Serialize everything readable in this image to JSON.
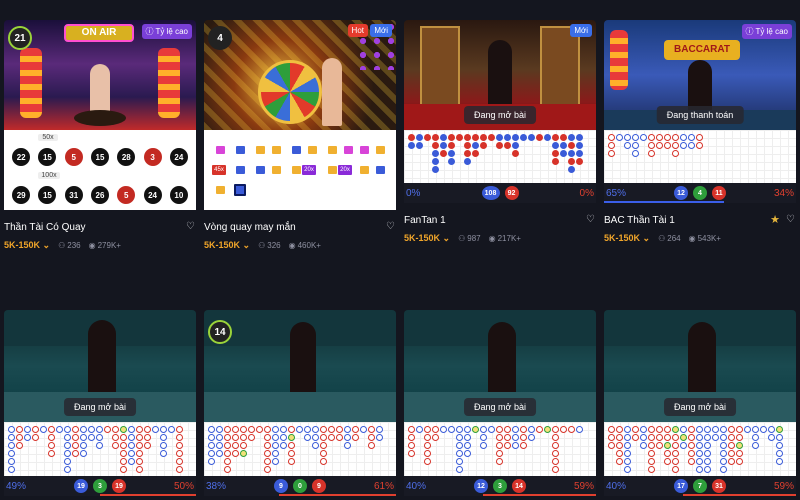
{
  "common": {
    "rate_badge": "Tỷ lệ cao",
    "hot_badge": "Hot",
    "new_badge": "Mới",
    "status_open": "Đang mở bài",
    "status_pay": "Đang thanh toán"
  },
  "colors": {
    "bg": "#14161f",
    "accent_bet": "#f0a52a",
    "player_blue": "#3a5bd8",
    "banker_red": "#d7332a",
    "tie_green": "#2e9e3b"
  },
  "cards": [
    {
      "title": "Thần Tài Có Quay",
      "bet": "5K-150K",
      "players": "236",
      "views": "279K+",
      "timer": "21",
      "multipliers": [
        "50x",
        "100x"
      ],
      "numbers_row1": [
        "22",
        "15",
        "5",
        "15",
        "28",
        "3",
        "24"
      ],
      "numbers_row2": [
        "29",
        "15",
        "31",
        "26",
        "5",
        "24",
        "10"
      ]
    },
    {
      "title": "Vòng quay may mắn",
      "bet": "5K-150K",
      "players": "326",
      "views": "460K+",
      "timer": "4",
      "chips": [
        "45x",
        "20x",
        "20x"
      ]
    },
    {
      "title": "FanTan 1",
      "bet": "5K-150K",
      "players": "987",
      "views": "217K+",
      "pct_left": "0%",
      "pct_right": "0%",
      "coin_left": "108",
      "coin_right": "92"
    },
    {
      "title": "BAC Thần Tài 1",
      "bet": "5K-150K",
      "players": "264",
      "views": "543K+",
      "pct_left": "65%",
      "pct_right": "34%",
      "coin1": "12",
      "coin2": "4",
      "coin3": "11"
    },
    {
      "pct_left": "49%",
      "pct_right": "50%",
      "coin1": "19",
      "coin2": "3",
      "coin3": "19"
    },
    {
      "timer": "14",
      "pct_left": "38%",
      "pct_right": "61%",
      "coin1": "9",
      "coin2": "0",
      "coin3": "9"
    },
    {
      "pct_left": "40%",
      "pct_right": "59%",
      "coin1": "12",
      "coin2": "3",
      "coin3": "14"
    },
    {
      "pct_left": "40%",
      "pct_right": "59%",
      "coin1": "17",
      "coin2": "7",
      "coin3": "31"
    }
  ]
}
